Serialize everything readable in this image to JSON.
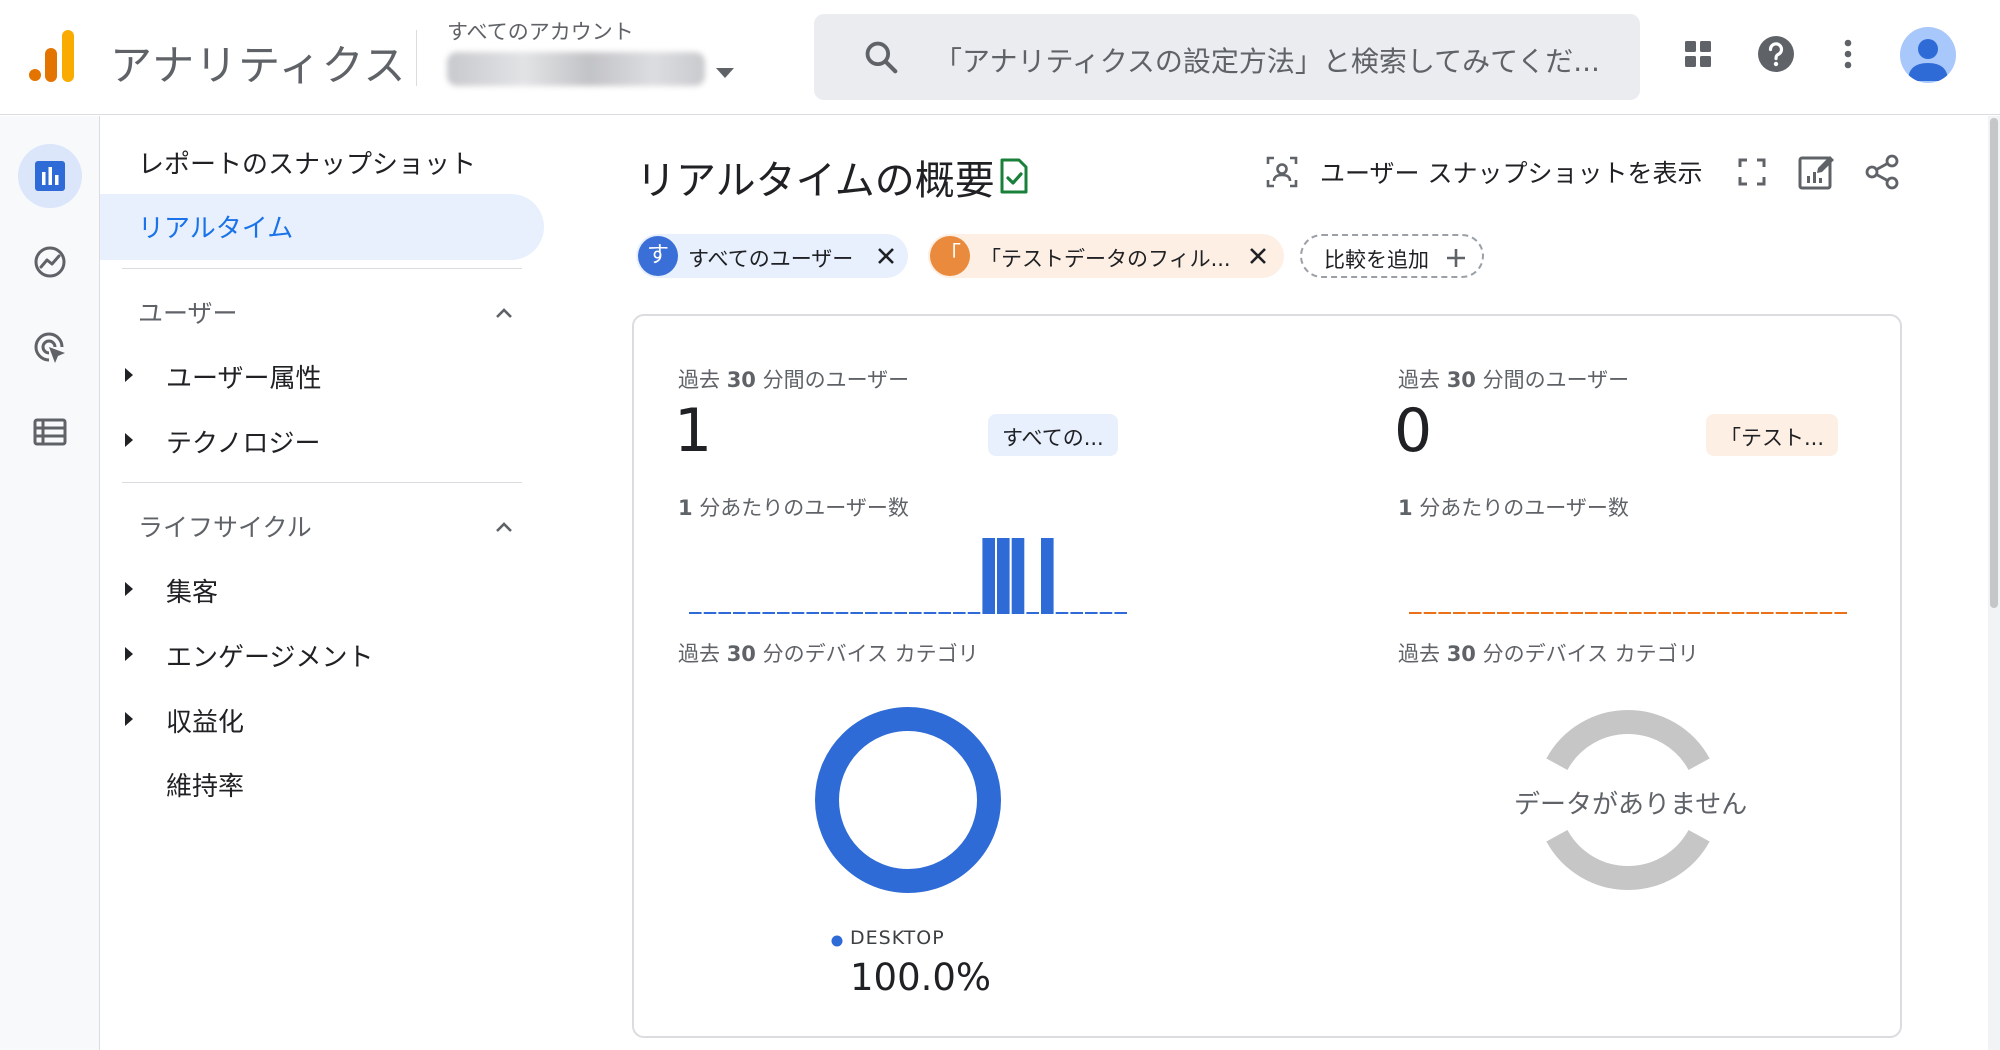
{
  "app": {
    "title": "アナリティクス",
    "account_label": "すべてのアカウント",
    "account_name": "",
    "search_placeholder": "「アナリティクスの設定方法」と検索してみてくだ..."
  },
  "nav": {
    "snapshot": "レポートのスナップショット",
    "realtime": "リアルタイム",
    "sections": [
      {
        "title": "ユーザー",
        "items": [
          "ユーザー属性",
          "テクノロジー"
        ]
      },
      {
        "title": "ライフサイクル",
        "items": [
          "集客",
          "エンゲージメント",
          "収益化",
          "維持率"
        ]
      }
    ]
  },
  "main": {
    "title": "リアルタイムの概要",
    "view_snapshot": "ユーザー スナップショットを表示",
    "chips": [
      {
        "dot": "す",
        "label": "すべてのユーザー",
        "color": "#3b6fd8",
        "bg": "#e8f0fe"
      },
      {
        "dot": "「",
        "label": "「テストデータのフィル...",
        "color": "#ea8a3d",
        "bg": "#fdefe3"
      }
    ],
    "add_comparison": "比較を追加"
  },
  "panels": [
    {
      "users_label_prefix": "過去 ",
      "users_label_num": "30",
      "users_label_suffix": " 分間のユーザー",
      "value": "1",
      "badge": "すべての...",
      "badge_bg": "#e8f0fe",
      "per_min_label_num": "1",
      "per_min_label_suffix": " 分あたりのユーザー数",
      "device_label_prefix": "過去 ",
      "device_label_num": "30",
      "device_label_suffix": " 分のデバイス カテゴリ",
      "color": "#2f6bd6",
      "legend": "DESKTOP",
      "pct": "100.0%"
    },
    {
      "users_label_prefix": "過去 ",
      "users_label_num": "30",
      "users_label_suffix": " 分間のユーザー",
      "value": "0",
      "badge": "「テスト...",
      "badge_bg": "#fdefe3",
      "per_min_label_num": "1",
      "per_min_label_suffix": " 分あたりのユーザー数",
      "device_label_prefix": "過去 ",
      "device_label_num": "30",
      "device_label_suffix": " 分のデバイス カテゴリ",
      "color": "#e8711a",
      "no_data": "データがありません"
    }
  ],
  "chart_data": [
    {
      "type": "bar",
      "series": [
        {
          "values": [
            0,
            0,
            0,
            0,
            0,
            0,
            0,
            0,
            0,
            0,
            0,
            0,
            0,
            0,
            0,
            0,
            0,
            0,
            0,
            0,
            1,
            1,
            1,
            0,
            1,
            0,
            0,
            0,
            0,
            0
          ]
        }
      ],
      "color": "#2f6bd6"
    },
    {
      "type": "bar",
      "series": [
        {
          "values": [
            0,
            0,
            0,
            0,
            0,
            0,
            0,
            0,
            0,
            0,
            0,
            0,
            0,
            0,
            0,
            0,
            0,
            0,
            0,
            0,
            0,
            0,
            0,
            0,
            0,
            0,
            0,
            0,
            0,
            0
          ]
        }
      ],
      "color": "#e8711a"
    },
    {
      "type": "pie",
      "categories": [
        "DESKTOP"
      ],
      "values": [
        100.0
      ],
      "color": "#2f6bd6"
    }
  ]
}
